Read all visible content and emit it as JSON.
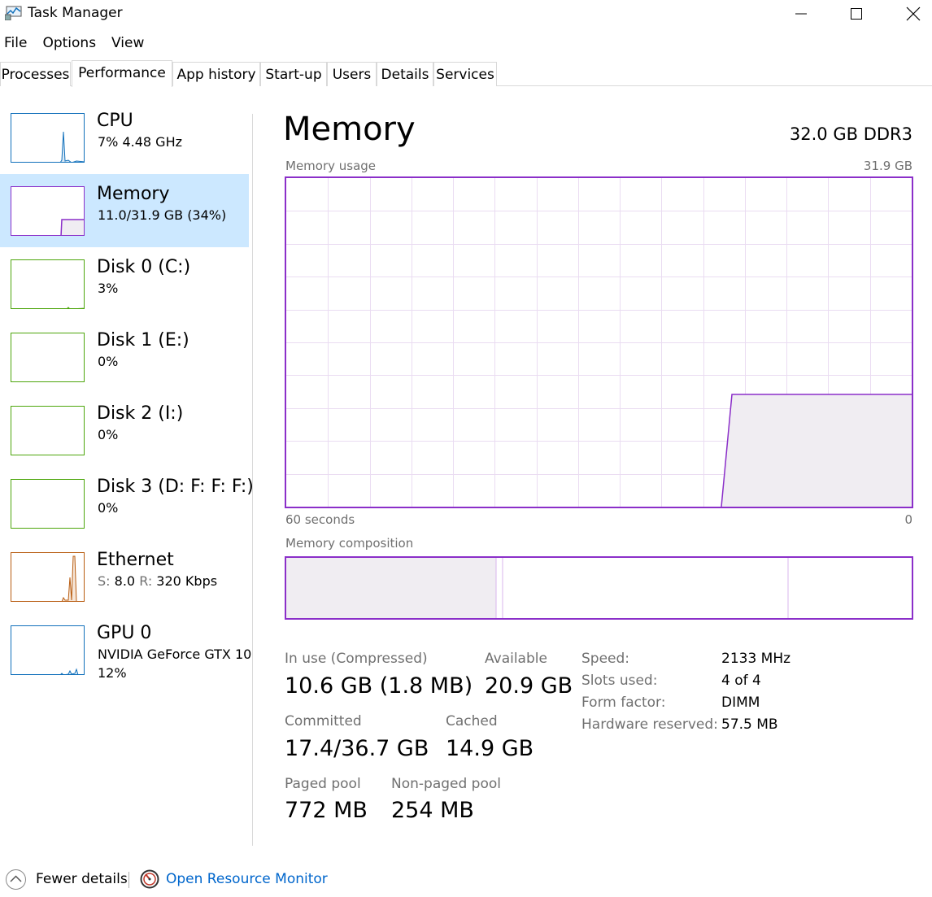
{
  "window": {
    "title": "Task Manager"
  },
  "menu": [
    "File",
    "Options",
    "View"
  ],
  "tabs": [
    "Processes",
    "Performance",
    "App history",
    "Start-up",
    "Users",
    "Details",
    "Services"
  ],
  "active_tab": "Performance",
  "sidebar": [
    {
      "title": "CPU",
      "sub": "7% 4.48 GHz",
      "color": "#1170bb"
    },
    {
      "title": "Memory",
      "sub": "11.0/31.9 GB (34%)",
      "color": "#8b2fc9"
    },
    {
      "title": "Disk 0 (C:)",
      "sub": "3%",
      "color": "#4da60c"
    },
    {
      "title": "Disk 1 (E:)",
      "sub": "0%",
      "color": "#4da60c"
    },
    {
      "title": "Disk 2 (I:)",
      "sub": "0%",
      "color": "#4da60c"
    },
    {
      "title": "Disk 3 (D: F: F: F:)",
      "sub": "0%",
      "color": "#4da60c"
    },
    {
      "title": "Ethernet",
      "sub_label_s": "S:",
      "sub_value_s": "8.0",
      "sub_label_r": "R:",
      "sub_value_r": "320 Kbps",
      "color": "#b85c10"
    },
    {
      "title": "GPU 0",
      "sub": "NVIDIA GeForce GTX 10",
      "sub2": "12%",
      "color": "#1170bb"
    }
  ],
  "main": {
    "title": "Memory",
    "spec": "32.0 GB DDR3",
    "usage_label": "Memory usage",
    "usage_max": "31.9 GB",
    "time_left": "60 seconds",
    "time_right": "0",
    "composition_label": "Memory composition",
    "stats": {
      "in_use_label": "In use (Compressed)",
      "in_use_value": "10.6 GB (1.8 MB)",
      "available_label": "Available",
      "available_value": "20.9 GB",
      "committed_label": "Committed",
      "committed_value": "17.4/36.7 GB",
      "cached_label": "Cached",
      "cached_value": "14.9 GB",
      "paged_label": "Paged pool",
      "paged_value": "772 MB",
      "nonpaged_label": "Non-paged pool",
      "nonpaged_value": "254 MB"
    },
    "specs": [
      {
        "label": "Speed:",
        "value": "2133 MHz"
      },
      {
        "label": "Slots used:",
        "value": "4 of 4"
      },
      {
        "label": "Form factor:",
        "value": "DIMM"
      },
      {
        "label": "Hardware reserved:",
        "value": "57.5 MB"
      }
    ]
  },
  "footer": {
    "fewer_details": "Fewer details",
    "open_resource_monitor": "Open Resource Monitor"
  },
  "colors": {
    "memory": "#8b2fc9",
    "selected_bg": "#cce8ff",
    "link": "#0066cc",
    "grid": "#eadcf2",
    "fill": "#f0edf2"
  }
}
